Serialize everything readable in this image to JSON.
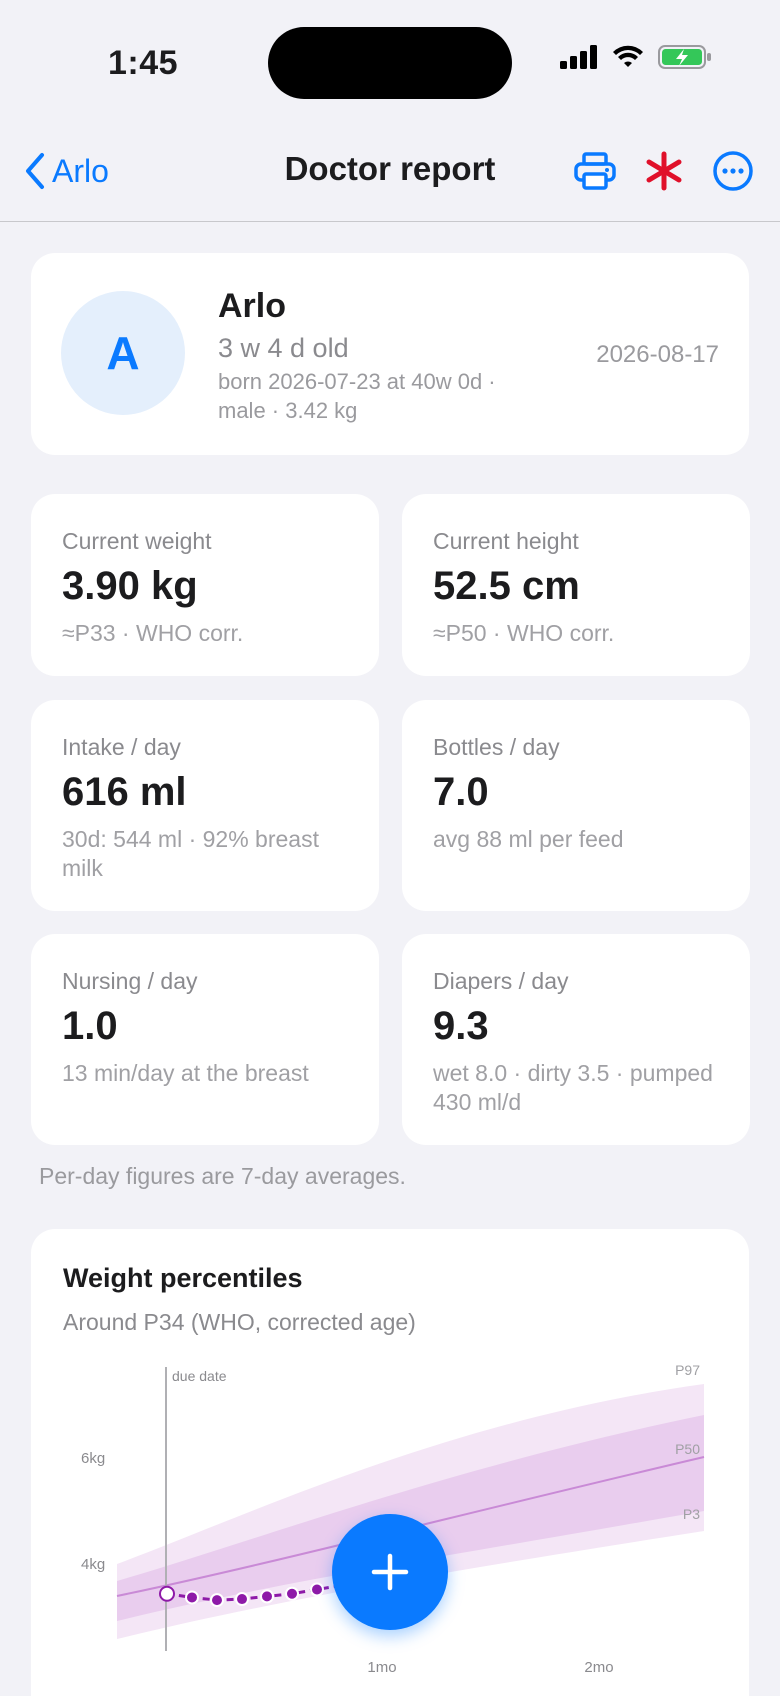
{
  "status_bar": {
    "time": "1:45"
  },
  "nav": {
    "back_label": "Arlo",
    "title": "Doctor report",
    "icons": [
      "printer-icon",
      "asterisk-icon",
      "more-icon"
    ],
    "accent": "#0a7aff",
    "asterisk_color": "#e0102a"
  },
  "profile": {
    "initial": "A",
    "name": "Arlo",
    "age": "3 w 4 d old",
    "born": "born 2026-07-23 at 40w 0d · male · 3.42 kg",
    "date": "2026-08-17"
  },
  "stats": [
    {
      "label": "Current weight",
      "value": "3.90 kg",
      "sub": "≈P33 · WHO corr."
    },
    {
      "label": "Current height",
      "value": "52.5 cm",
      "sub": "≈P50 · WHO corr."
    },
    {
      "label": "Intake / day",
      "value": "616 ml",
      "sub": "30d: 544 ml · 92% breast milk"
    },
    {
      "label": "Bottles / day",
      "value": "7.0",
      "sub": "avg 88 ml per feed"
    },
    {
      "label": "Nursing / day",
      "value": "1.0",
      "sub": "13 min/day at the breast"
    },
    {
      "label": "Diapers / day",
      "value": "9.3",
      "sub": "wet 8.0 · dirty 3.5 · pumped 430 ml/d"
    }
  ],
  "footnote": "Per-day figures are 7-day averages.",
  "chart_card": {
    "title": "Weight percentiles",
    "subtitle": "Around P34 (WHO, corrected age)"
  },
  "chart_data": {
    "type": "area",
    "y_ticks": [
      "6kg",
      "4kg"
    ],
    "x_ticks": [
      "1mo",
      "2mo"
    ],
    "reference_line_label": "due date",
    "band_labels": [
      "P97",
      "P50",
      "P3"
    ],
    "series_color": "#8e1aa8",
    "band_color": "#e7c9ee",
    "measurements_kg": [
      3.42,
      3.35,
      3.3,
      3.32,
      3.37,
      3.42,
      3.5,
      3.58,
      3.65,
      3.72,
      3.9
    ]
  },
  "fab": {
    "icon": "plus-icon"
  }
}
